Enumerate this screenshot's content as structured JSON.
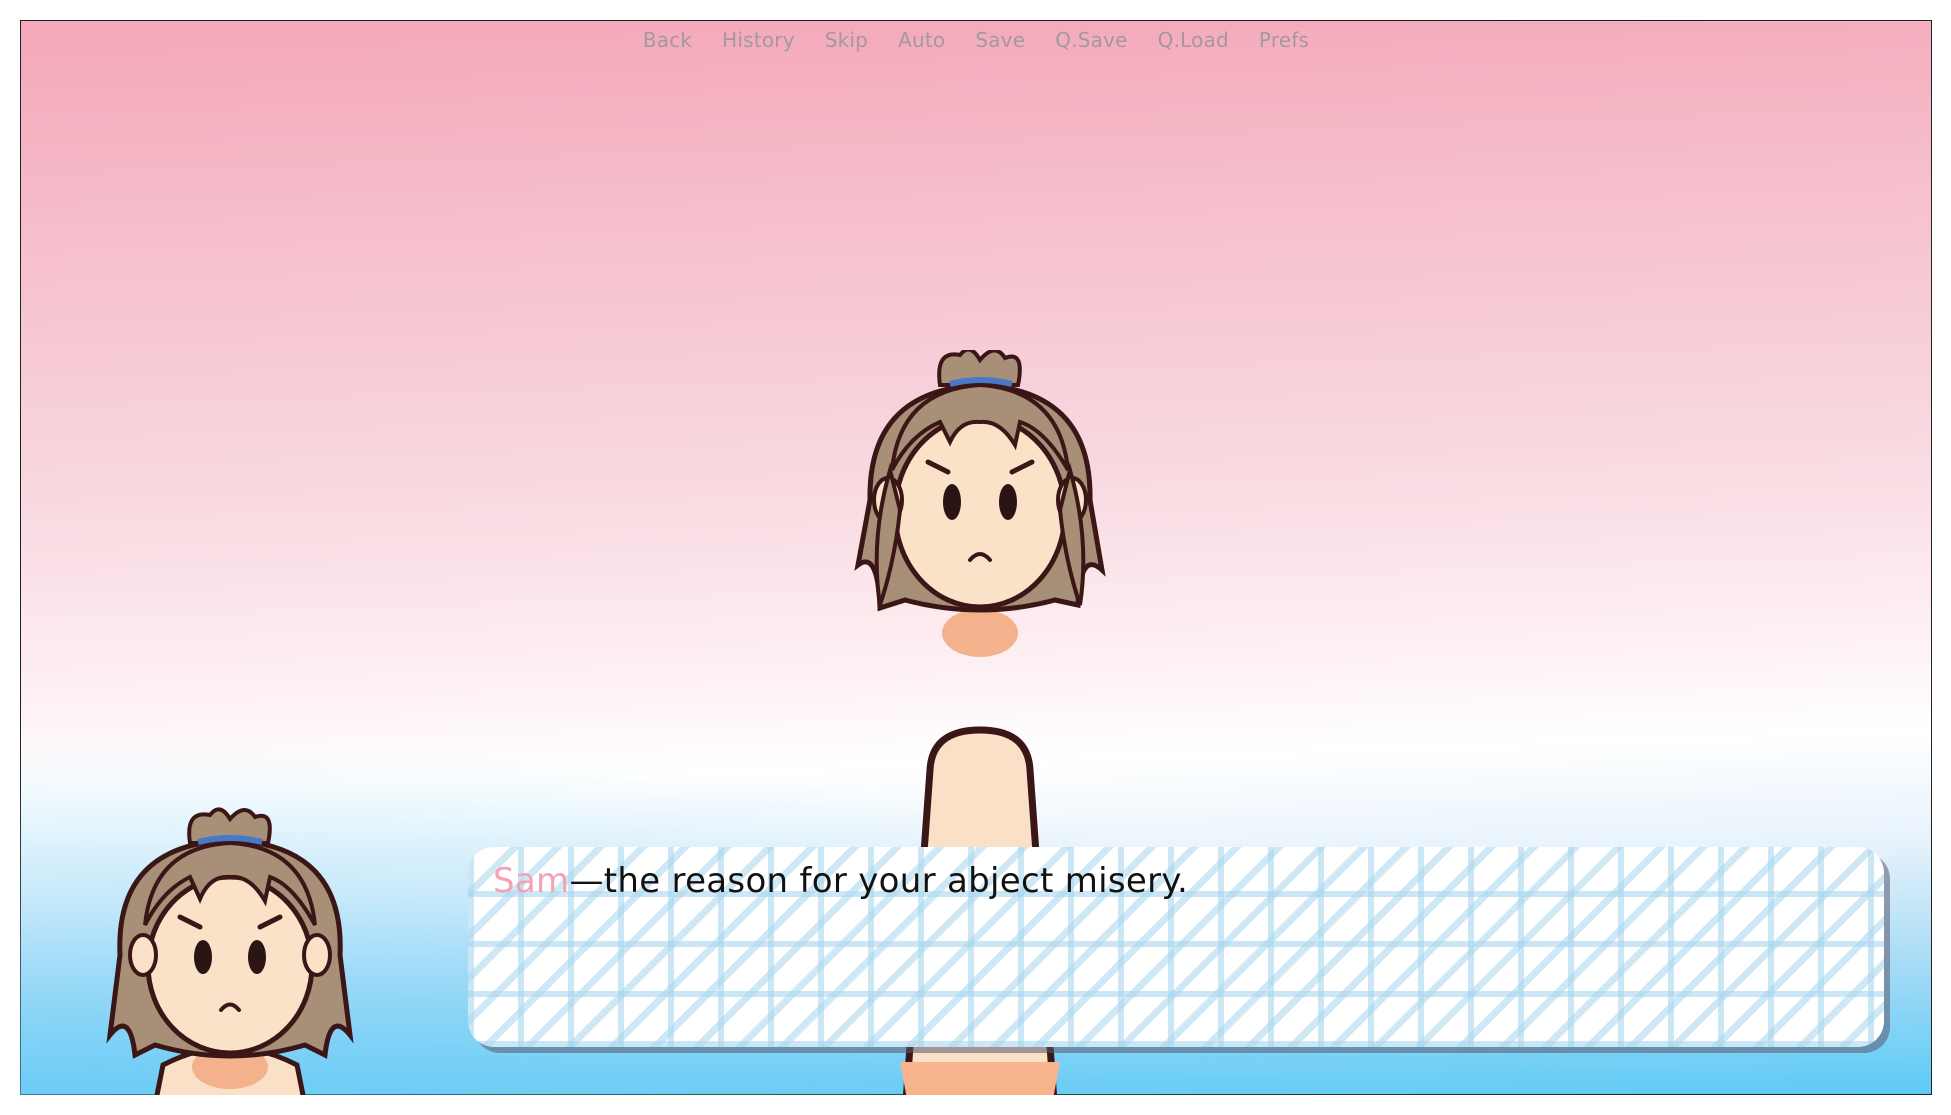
{
  "quick_menu": [
    "Back",
    "History",
    "Skip",
    "Auto",
    "Save",
    "Q.Save",
    "Q.Load",
    "Prefs"
  ],
  "dialogue": {
    "speaker": "Sam",
    "text": "—the reason for your abject misery."
  },
  "colors": {
    "speaker_name": "#f4a3b5",
    "menu_text": "#a3999c",
    "bg_top": "#f4a7b9",
    "bg_bottom": "#5ccaf6"
  },
  "sprites": [
    "character-sam-center",
    "character-sam-side-portrait"
  ]
}
